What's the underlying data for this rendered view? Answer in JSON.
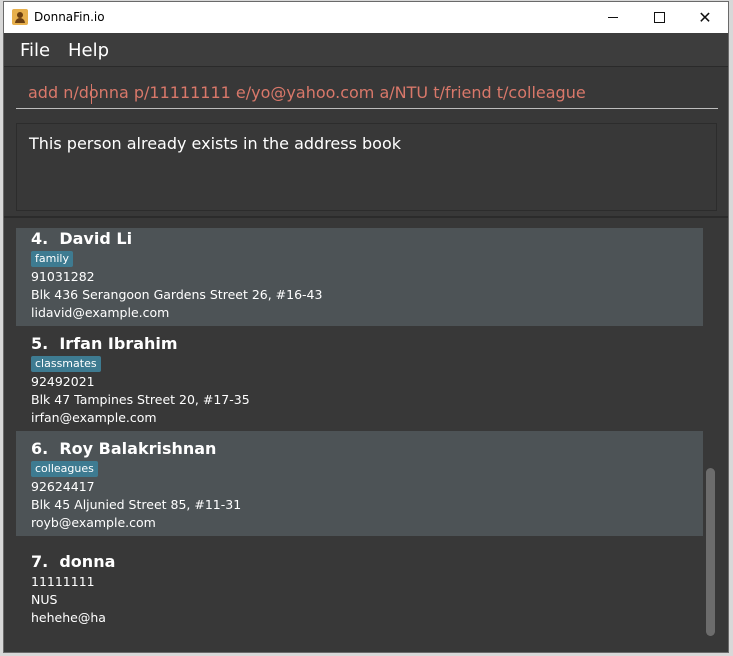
{
  "window": {
    "title": "DonnaFin.io"
  },
  "menu": {
    "file": "File",
    "help": "Help"
  },
  "command": {
    "value": "add n/donna p/11111111 e/yo@yahoo.com a/NTU t/friend t/colleague"
  },
  "result": {
    "message": "This person already exists in the address book"
  },
  "persons": [
    {
      "index_name": "4.  David Li",
      "tag": "family",
      "phone": "91031282",
      "address": "Blk 436 Serangoon Gardens Street 26, #16-43",
      "email": "lidavid@example.com"
    },
    {
      "index_name": "5.  Irfan Ibrahim",
      "tag": "classmates",
      "phone": "92492021",
      "address": "Blk 47 Tampines Street 20, #17-35",
      "email": "irfan@example.com"
    },
    {
      "index_name": "6.  Roy Balakrishnan",
      "tag": "colleagues",
      "phone": "92624417",
      "address": "Blk 45 Aljunied Street 85, #11-31",
      "email": "royb@example.com"
    },
    {
      "index_name": "7.  donna",
      "phone": "11111111",
      "address": "NUS",
      "email": "hehehe@ha"
    }
  ],
  "colors": {
    "background": "#383838",
    "card_alt": "#4d5356",
    "tag": "#3e7b91",
    "command_text": "#d9786a"
  }
}
